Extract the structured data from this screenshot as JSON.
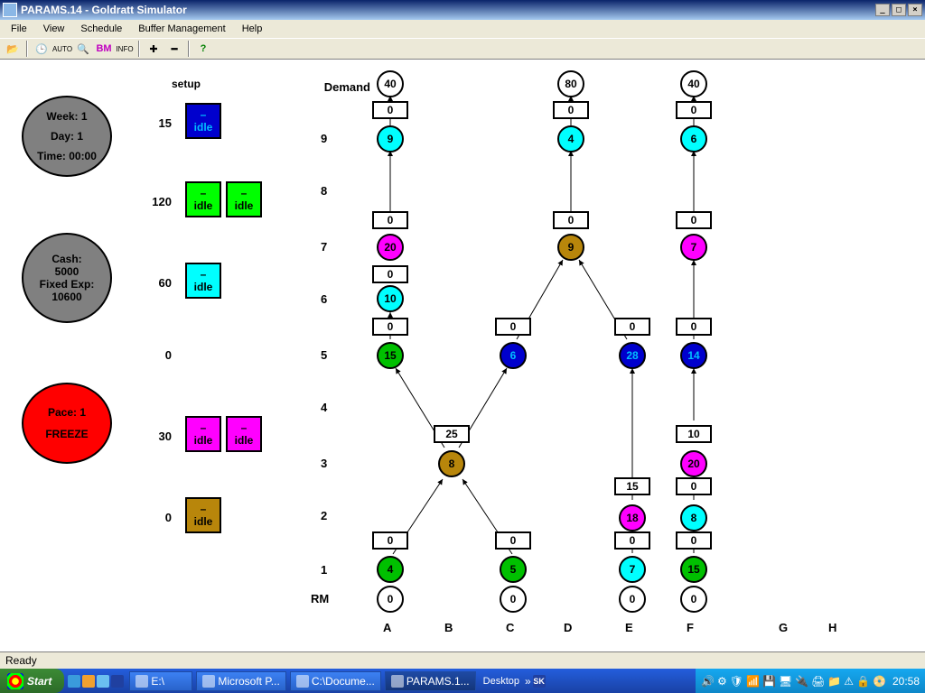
{
  "window": {
    "title": "PARAMS.14 - Goldratt Simulator"
  },
  "menu": [
    "File",
    "View",
    "Schedule",
    "Buffer Management",
    "Help"
  ],
  "toolbar": {
    "auto": "AUTO",
    "bm": "BM",
    "info": "INFO"
  },
  "status": "Ready",
  "clock": "20:58",
  "taskbar": {
    "start": "Start",
    "items": [
      {
        "label": "E:\\"
      },
      {
        "label": "Microsoft P..."
      },
      {
        "label": "C:\\Docume..."
      },
      {
        "label": "PARAMS.1...",
        "active": true
      }
    ],
    "desktop": "Desktop"
  },
  "time_panel": {
    "week": "Week: 1",
    "day": "Day: 1",
    "time": "Time: 00:00"
  },
  "cash_panel": {
    "cash_lbl": "Cash:",
    "cash": "5000",
    "exp_lbl": "Fixed Exp:",
    "exp": "10600"
  },
  "pace_panel": {
    "pace": "Pace: 1",
    "freeze": "FREEZE"
  },
  "setup_header": "setup",
  "resources": [
    {
      "time": "15",
      "boxes": [
        {
          "txt": "idle",
          "color": "#0000cd",
          "fg": "#00bfff"
        }
      ]
    },
    {
      "time": "120",
      "boxes": [
        {
          "txt": "idle",
          "color": "#00ff00",
          "fg": "#000"
        },
        {
          "txt": "idle",
          "color": "#00ff00",
          "fg": "#000"
        }
      ]
    },
    {
      "time": "60",
      "boxes": [
        {
          "txt": "idle",
          "color": "#00ffff",
          "fg": "#000"
        }
      ]
    },
    {
      "time": "0",
      "boxes": []
    },
    {
      "time": "30",
      "boxes": [
        {
          "txt": "idle",
          "color": "#ff00ff",
          "fg": "#000"
        },
        {
          "txt": "idle",
          "color": "#ff00ff",
          "fg": "#000"
        }
      ]
    },
    {
      "time": "0",
      "boxes": [
        {
          "txt": "idle",
          "color": "#b8860b",
          "fg": "#000"
        }
      ]
    }
  ],
  "rows": {
    "demand": "Demand",
    "9": "9",
    "8": "8",
    "7": "7",
    "6": "6",
    "5": "5",
    "4": "4",
    "3": "3",
    "2": "2",
    "1": "1",
    "rm": "RM"
  },
  "cols": [
    "A",
    "B",
    "C",
    "D",
    "E",
    "F",
    "G",
    "H"
  ],
  "demand": {
    "A": "40",
    "D": "80",
    "F": "40"
  },
  "demand_buf": {
    "A": "0",
    "D": "0",
    "F": "0"
  },
  "nodes": {
    "A9": {
      "v": "9",
      "c": "#00ffff"
    },
    "D9": {
      "v": "4",
      "c": "#00ffff"
    },
    "F9": {
      "v": "6",
      "c": "#00ffff"
    },
    "A7": {
      "v": "20",
      "c": "#ff00ff"
    },
    "D7": {
      "v": "9",
      "c": "#b8860b"
    },
    "F7": {
      "v": "7",
      "c": "#ff00ff"
    },
    "A6": {
      "v": "10",
      "c": "#00ffff"
    },
    "A5": {
      "v": "15",
      "c": "#00c000",
      "fg": "#000"
    },
    "C5": {
      "v": "6",
      "c": "#0000cd",
      "fg": "#00bfff"
    },
    "E5": {
      "v": "28",
      "c": "#0000cd",
      "fg": "#00bfff"
    },
    "F5": {
      "v": "14",
      "c": "#0000cd",
      "fg": "#00bfff"
    },
    "B3": {
      "v": "8",
      "c": "#b8860b"
    },
    "F3": {
      "v": "20",
      "c": "#ff00ff"
    },
    "E2": {
      "v": "18",
      "c": "#ff00ff"
    },
    "F2": {
      "v": "8",
      "c": "#00ffff"
    },
    "A1": {
      "v": "4",
      "c": "#00c000"
    },
    "C1": {
      "v": "5",
      "c": "#00c000"
    },
    "E1": {
      "v": "7",
      "c": "#00ffff"
    },
    "F1": {
      "v": "15",
      "c": "#00c000"
    },
    "ARM": {
      "v": "0",
      "c": "#ffffff"
    },
    "CRM": {
      "v": "0",
      "c": "#ffffff"
    },
    "ERM": {
      "v": "0",
      "c": "#ffffff"
    },
    "FRM": {
      "v": "0",
      "c": "#ffffff"
    }
  },
  "buffers": {
    "A7b": "0",
    "D7b": "0",
    "F7b": "0",
    "A6b": "0",
    "A5b": "0",
    "C5b": "0",
    "E5b": "0",
    "F5b": "0",
    "B3b": "25",
    "F4b": "10",
    "E2b": "15",
    "F3b": "0",
    "A1b": "0",
    "C1b": "0",
    "E1b": "0",
    "F1b": "0"
  }
}
